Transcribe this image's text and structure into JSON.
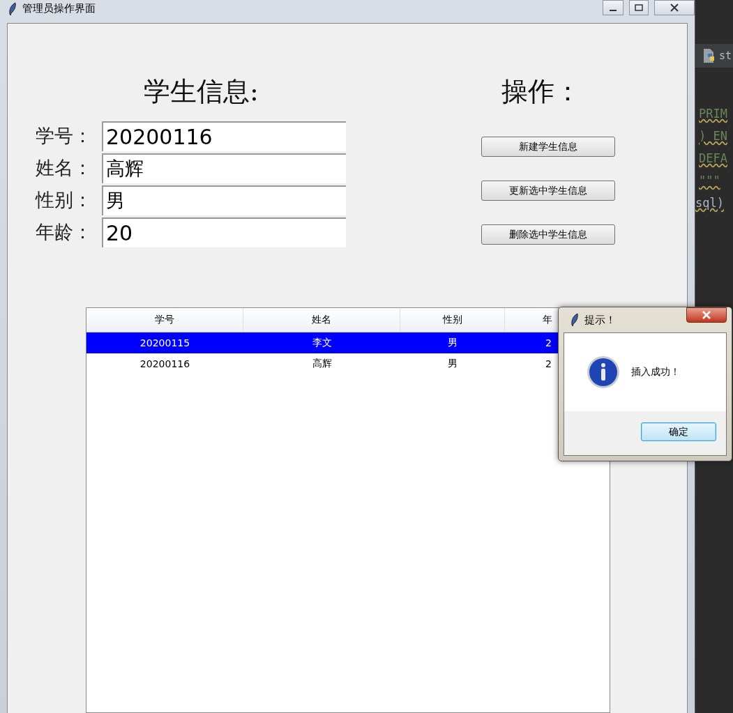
{
  "main_window": {
    "title": "管理员操作界面",
    "student_form": {
      "heading": "学生信息:",
      "fields": [
        {
          "label": "学号：",
          "value": "20200116"
        },
        {
          "label": "姓名：",
          "value": "高辉"
        },
        {
          "label": "性别：",
          "value": "男"
        },
        {
          "label": "年龄：",
          "value": "20"
        }
      ]
    },
    "operations": {
      "heading": "操作：",
      "buttons": [
        "新建学生信息",
        "更新选中学生信息",
        "删除选中学生信息"
      ]
    },
    "table": {
      "columns": [
        "学号",
        "姓名",
        "性别",
        "年"
      ],
      "rows": [
        {
          "cells": [
            "20200115",
            "李文",
            "男",
            "2"
          ],
          "selected": true
        },
        {
          "cells": [
            "20200116",
            "高辉",
            "男",
            "2"
          ],
          "selected": false
        }
      ]
    }
  },
  "background_editor": {
    "tab": "st",
    "lines": [
      {
        "text": "PRIM",
        "kind": "string"
      },
      {
        "text": ") EN",
        "kind": "string"
      },
      {
        "text": "DEFA",
        "kind": "string"
      },
      {
        "text": "\"\"\"",
        "kind": "string"
      },
      {
        "text": "sql)",
        "kind": "code"
      }
    ]
  },
  "dialog": {
    "title": "提示！",
    "message": "插入成功！",
    "buttons": [
      {
        "label": "确定",
        "focused": true
      }
    ]
  }
}
